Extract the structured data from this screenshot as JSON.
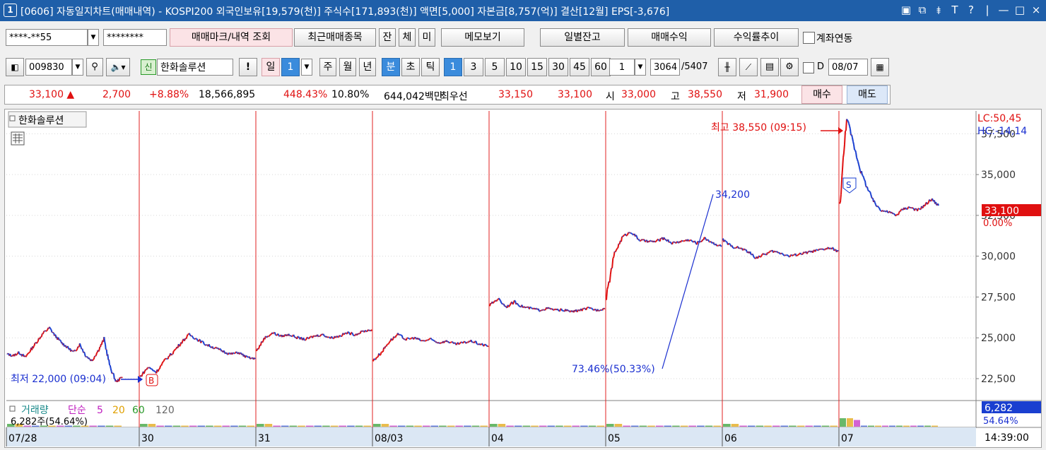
{
  "window": {
    "number": "1",
    "title": "[0606] 자동일지차트(매매내역) - KOSPI200 외국인보유[19,579(천)] 주식수[171,893(천)] 액면[5,000] 자본금[8,757(억)] 결산[12월] EPS[-3,676]",
    "controls": [
      "▣",
      "⧉",
      "⯒",
      "T",
      "?",
      "|",
      "—",
      "□",
      "×"
    ]
  },
  "toolbar1": {
    "account": "****-**55",
    "password": "********",
    "mark_query": "매매마크/내역 조회",
    "recent": "최근매매종목",
    "jan": "잔",
    "che": "체",
    "mi": "미",
    "memo": "메모보기",
    "daily_balance": "일별잔고",
    "trade_profit": "매매수익",
    "return_trend": "수익률추이",
    "account_link": "계좌연동"
  },
  "toolbar2": {
    "code": "009830",
    "new_badge": "신",
    "stock_name": "한화솔루션",
    "alert": "!",
    "il": "일",
    "il_num": "1",
    "periods": [
      "주",
      "월",
      "년"
    ],
    "bun": "분",
    "cho": "초",
    "tick": "틱",
    "intervals": [
      "1",
      "3",
      "5",
      "10",
      "15",
      "30",
      "45",
      "60"
    ],
    "count": "1",
    "bars_shown": "3064",
    "bars_total": "/5407",
    "d_label": "D",
    "date": "08/07"
  },
  "info": {
    "price": "33,100 ▲",
    "change": "2,700",
    "change_pct": "+8.88%",
    "volume": "18,566,895",
    "vol_ratio": "448.43%",
    "turnover": "10.80%",
    "amount": "644,042백만",
    "best_label": "최우선",
    "best_ask": "33,150",
    "best_bid": "33,100",
    "open_label": "시",
    "open": "33,000",
    "high_label": "고",
    "high": "38,550",
    "low_label": "저",
    "low": "31,900",
    "buy": "매수",
    "sell": "매도"
  },
  "chart_data": {
    "type": "line",
    "stock_label": "한화솔루션",
    "y_ticks": [
      "37,500",
      "35,000",
      "32,500",
      "30,000",
      "27,500",
      "25,000",
      "22,500"
    ],
    "ylim": [
      21200,
      38900
    ],
    "x_ticks": [
      "07/28",
      "30",
      "31",
      "08/03",
      "04",
      "05",
      "06",
      "07"
    ],
    "time_label": "14:39:00",
    "lc": "LC:50,45",
    "hc": "HC:-14,14",
    "current_price_tag": "33,100",
    "current_pct_tag": "0.00%",
    "high_annotation": "최고 38,550 (09:15)",
    "low_annotation": "최저 22,000 (09:04)",
    "trend_end_label": "34,200",
    "trend_start_label": "73.46%(50.33%)",
    "buy_mark": "B",
    "sell_mark": "S",
    "sessions": [
      {
        "day": "07/28",
        "open": 24000,
        "close": 22600,
        "points": [
          24000,
          23900,
          24100,
          23800,
          24300,
          24800,
          25300,
          25600,
          25100,
          24700,
          24400,
          24100,
          24600,
          23900,
          23600,
          24200,
          24900,
          23200,
          22300,
          22600
        ]
      },
      {
        "day": "30",
        "open": 22600,
        "close": 23700,
        "points": [
          22600,
          23200,
          22900,
          23600,
          24100,
          24700,
          25200,
          24900,
          24600,
          24400,
          24200,
          24000,
          24100,
          23800,
          23700
        ]
      },
      {
        "day": "31",
        "open": 24200,
        "close": 25500,
        "points": [
          24200,
          25000,
          25300,
          25100,
          25200,
          25000,
          24900,
          25100,
          25200,
          25000,
          25100,
          25300,
          25200,
          25400,
          25500
        ]
      },
      {
        "day": "08/03",
        "open": 23600,
        "close": 24500,
        "points": [
          23600,
          24100,
          24800,
          25200,
          24900,
          25000,
          24800,
          24900,
          24700,
          24800,
          24600,
          24700,
          24800,
          24600,
          24500
        ]
      },
      {
        "day": "04",
        "open": 27000,
        "close": 26800,
        "points": [
          27000,
          27400,
          26900,
          27200,
          26900,
          26800,
          26700,
          26800,
          26700,
          26700,
          26600,
          26700,
          26800,
          26700,
          26800
        ]
      },
      {
        "day": "05",
        "open": 27500,
        "close": 30600,
        "points": [
          27500,
          30200,
          31200,
          31500,
          31000,
          30900,
          30900,
          31100,
          30800,
          30900,
          31000,
          30800,
          31100,
          30800,
          30600
        ]
      },
      {
        "day": "06",
        "open": 31000,
        "close": 30300,
        "points": [
          31000,
          30600,
          30500,
          30300,
          29900,
          30100,
          30300,
          30200,
          30000,
          30100,
          30200,
          30300,
          30400,
          30500,
          30300
        ]
      },
      {
        "day": "07",
        "open": 33000,
        "close": 33100,
        "points": [
          33000,
          38550,
          36800,
          35200,
          34100,
          33200,
          32800,
          32700,
          32500,
          32900,
          33000,
          32800,
          33100,
          33500,
          33100
        ]
      }
    ],
    "volume_panel": {
      "label": "거래량",
      "ma_label": "단순",
      "ma_periods": [
        "5",
        "20",
        "60",
        "120"
      ],
      "value_text": "6,282주(54.64%)",
      "tag_value": "6,282",
      "tag_pct": "54.64%"
    }
  },
  "colors": {
    "up": "#e01010",
    "down": "#1a3fd0",
    "titlebar": "#1f5fa9"
  }
}
